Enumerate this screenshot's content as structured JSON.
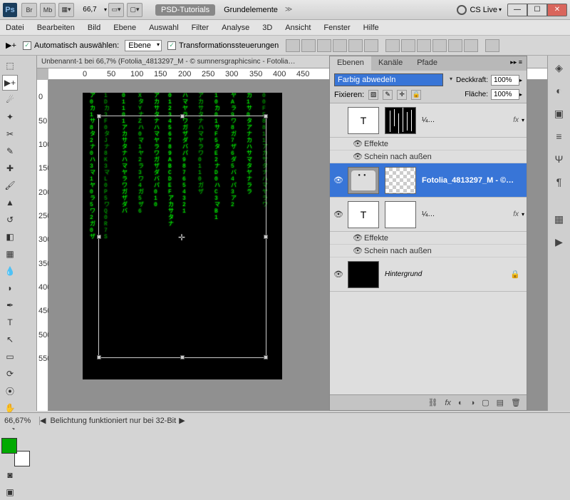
{
  "titlebar": {
    "zoom_dropdown": "66,7",
    "workspace_active": "PSD-Tutorials",
    "workspace_other": "Grundelemente",
    "cslive": "CS Live"
  },
  "menu": [
    "Datei",
    "Bearbeiten",
    "Bild",
    "Ebene",
    "Auswahl",
    "Filter",
    "Analyse",
    "3D",
    "Ansicht",
    "Fenster",
    "Hilfe"
  ],
  "options": {
    "auto_select_label": "Automatisch auswählen:",
    "auto_select_target": "Ebene",
    "transform_label": "Transformationssteuerungen"
  },
  "document": {
    "tab": "Unbenannt-1 bei 66,7% (Fotolia_4813297_M - © sumnersgraphicsinc - Fotolia…",
    "ruler_h": [
      "0",
      "50",
      "100",
      "150",
      "200",
      "250",
      "300",
      "350",
      "400",
      "450"
    ],
    "ruler_v": [
      "0",
      "50",
      "100",
      "150",
      "200",
      "250",
      "300",
      "350",
      "400",
      "450",
      "500",
      "550"
    ]
  },
  "layers_panel": {
    "tabs": [
      "Ebenen",
      "Kanäle",
      "Pfade"
    ],
    "blend_mode": "Farbig abwedeln",
    "opacity_label": "Deckkraft:",
    "opacity_value": "100%",
    "lock_label": "Fixieren:",
    "fill_label": "Fläche:",
    "fill_value": "100%",
    "layers": [
      {
        "name": "¼…",
        "type": "text",
        "fx": "fx"
      },
      {
        "effects_label": "Effekte",
        "glow_label": "Schein nach außen"
      },
      {
        "name": "Fotolia_4813297_M - ©…",
        "type": "photo",
        "selected": true
      },
      {
        "name": "¼…",
        "type": "text2",
        "fx": "fx"
      },
      {
        "effects_label": "Effekte",
        "glow_label": "Schein nach außen"
      },
      {
        "name": "Hintergrund",
        "type": "bg"
      }
    ],
    "text_glyph": "T"
  },
  "statusbar": {
    "zoom": "66,67%",
    "info": "Belichtung funktioniert nur bei 32-Bit"
  }
}
